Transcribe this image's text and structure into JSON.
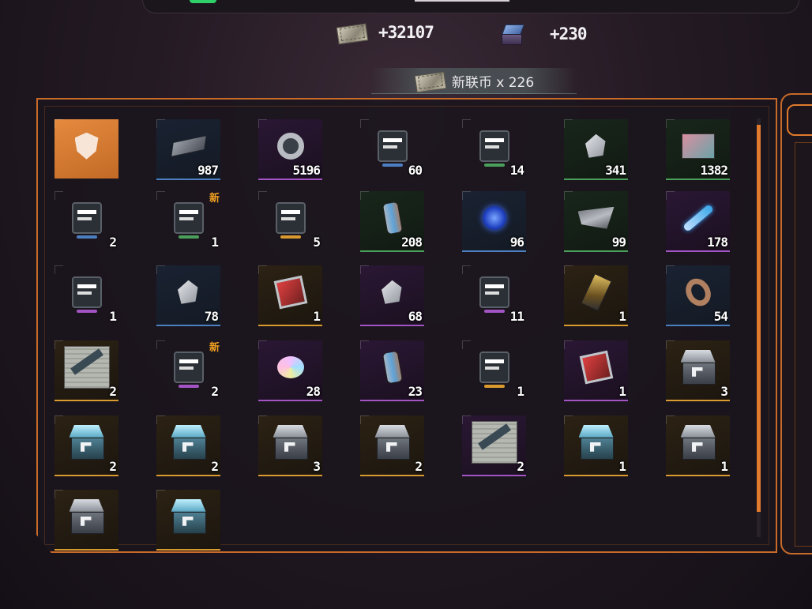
{
  "top_rewards": [
    {
      "icon": "cash-bundle-icon",
      "amount": "+32107"
    },
    {
      "icon": "data-cube-icon",
      "amount": "+230"
    }
  ],
  "currency_strip": {
    "icon": "cash-bundle-icon",
    "label": "新联币 x 226"
  },
  "colors": {
    "accent": "#e07a2c",
    "blue": "#4c7fc1",
    "purple": "#a254c4",
    "green": "#4aa05a",
    "gold": "#d99a30"
  },
  "items": [
    {
      "name": "badge-selected-icon",
      "rarity": "orange",
      "count": "",
      "new": ""
    },
    {
      "name": "alloy-plate-icon",
      "rarity": "blue",
      "count": "987",
      "new": ""
    },
    {
      "name": "gear-part-icon",
      "rarity": "purple",
      "count": "5196",
      "new": ""
    },
    {
      "name": "sparkle-chip-icon",
      "rarity": "plain",
      "count": "60",
      "new": ""
    },
    {
      "name": "weapon-mod-icon",
      "rarity": "plain",
      "count": "14",
      "new": ""
    },
    {
      "name": "rock-ore-icon",
      "rarity": "green",
      "count": "341",
      "new": ""
    },
    {
      "name": "paint-card-icon",
      "rarity": "green",
      "count": "1382",
      "new": ""
    },
    {
      "name": "wings-emblem-icon",
      "rarity": "plain",
      "count": "2",
      "new": ""
    },
    {
      "name": "weapon-mod-icon",
      "rarity": "plain",
      "count": "1",
      "new": "新"
    },
    {
      "name": "weapon-mod-icon",
      "rarity": "plain",
      "count": "5",
      "new": ""
    },
    {
      "name": "canister-icon",
      "rarity": "green",
      "count": "208",
      "new": ""
    },
    {
      "name": "energy-orb-icon",
      "rarity": "blue",
      "count": "96",
      "new": ""
    },
    {
      "name": "blade-sheet-icon",
      "rarity": "green",
      "count": "99",
      "new": ""
    },
    {
      "name": "syringe-icon",
      "rarity": "purple",
      "count": "178",
      "new": ""
    },
    {
      "name": "weapon-mod-icon",
      "rarity": "plain",
      "count": "1",
      "new": ""
    },
    {
      "name": "crystal-icon",
      "rarity": "blue",
      "count": "78",
      "new": ""
    },
    {
      "name": "emblem-chip-icon",
      "rarity": "gold",
      "count": "1",
      "new": ""
    },
    {
      "name": "crystal-cluster-icon",
      "rarity": "purple",
      "count": "68",
      "new": ""
    },
    {
      "name": "weapon-mod-icon",
      "rarity": "plain",
      "count": "11",
      "new": ""
    },
    {
      "name": "gold-card-icon",
      "rarity": "gold",
      "count": "1",
      "new": ""
    },
    {
      "name": "ring-part-icon",
      "rarity": "blue",
      "count": "54",
      "new": ""
    },
    {
      "name": "weapon-blueprint-icon",
      "rarity": "gold",
      "count": "2",
      "new": ""
    },
    {
      "name": "weapon-mod-icon",
      "rarity": "plain",
      "count": "2",
      "new": "新"
    },
    {
      "name": "holo-disc-icon",
      "rarity": "purple",
      "count": "28",
      "new": ""
    },
    {
      "name": "canister-icon",
      "rarity": "purple",
      "count": "23",
      "new": ""
    },
    {
      "name": "weapon-mod-icon",
      "rarity": "plain",
      "count": "1",
      "new": ""
    },
    {
      "name": "chip-blueprint-icon",
      "rarity": "purple",
      "count": "1",
      "new": ""
    },
    {
      "name": "supply-box-icon",
      "rarity": "gold",
      "count": "3",
      "new": ""
    },
    {
      "name": "supply-box-cyan-icon",
      "rarity": "gold",
      "count": "2",
      "new": ""
    },
    {
      "name": "supply-box-cyan-icon",
      "rarity": "gold",
      "count": "2",
      "new": ""
    },
    {
      "name": "supply-box-icon",
      "rarity": "gold",
      "count": "3",
      "new": ""
    },
    {
      "name": "supply-box-icon",
      "rarity": "gold",
      "count": "2",
      "new": ""
    },
    {
      "name": "blade-blueprint-icon",
      "rarity": "purple",
      "count": "2",
      "new": ""
    },
    {
      "name": "supply-box-cyan-icon",
      "rarity": "gold",
      "count": "1",
      "new": ""
    },
    {
      "name": "supply-box-icon",
      "rarity": "gold",
      "count": "1",
      "new": ""
    },
    {
      "name": "supply-box-icon",
      "rarity": "gold",
      "count": "",
      "new": ""
    },
    {
      "name": "supply-box-cyan-icon",
      "rarity": "gold",
      "count": "",
      "new": ""
    }
  ]
}
